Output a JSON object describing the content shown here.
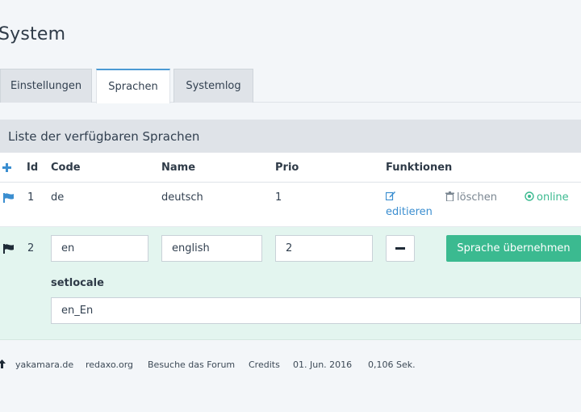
{
  "page": {
    "title": "System"
  },
  "tabs": [
    {
      "label": "Einstellungen"
    },
    {
      "label": "Sprachen"
    },
    {
      "label": "Systemlog"
    }
  ],
  "panel": {
    "heading": "Liste der verfügbaren Sprachen"
  },
  "table": {
    "headers": {
      "id": "Id",
      "code": "Code",
      "name": "Name",
      "prio": "Prio",
      "functions": "Funktionen"
    },
    "rows": [
      {
        "id": "1",
        "code": "de",
        "name": "deutsch",
        "prio": "1",
        "edit_line1": "",
        "edit_line2": "editieren",
        "delete_label": "löschen",
        "status_label": "online"
      }
    ],
    "edit_row": {
      "id": "2",
      "code_value": "en",
      "name_value": "english",
      "prio_value": "2",
      "submit_label": "Sprache übernehmen",
      "setlocale_label": "setlocale",
      "setlocale_value": "en_En"
    }
  },
  "footer": {
    "links": [
      "yakamara.de",
      "redaxo.org",
      "Besuche das Forum",
      "Credits"
    ],
    "date": "01. Jun. 2016",
    "time": "0,106 Sek."
  },
  "colors": {
    "accent": "#3b8ed0",
    "success": "#3bba90",
    "edit_row_bg": "#e3f5ef"
  },
  "icons": [
    "plus-icon",
    "flag-icon",
    "edit-icon",
    "trash-icon",
    "online-icon",
    "minus-icon",
    "arrow-up-icon"
  ]
}
